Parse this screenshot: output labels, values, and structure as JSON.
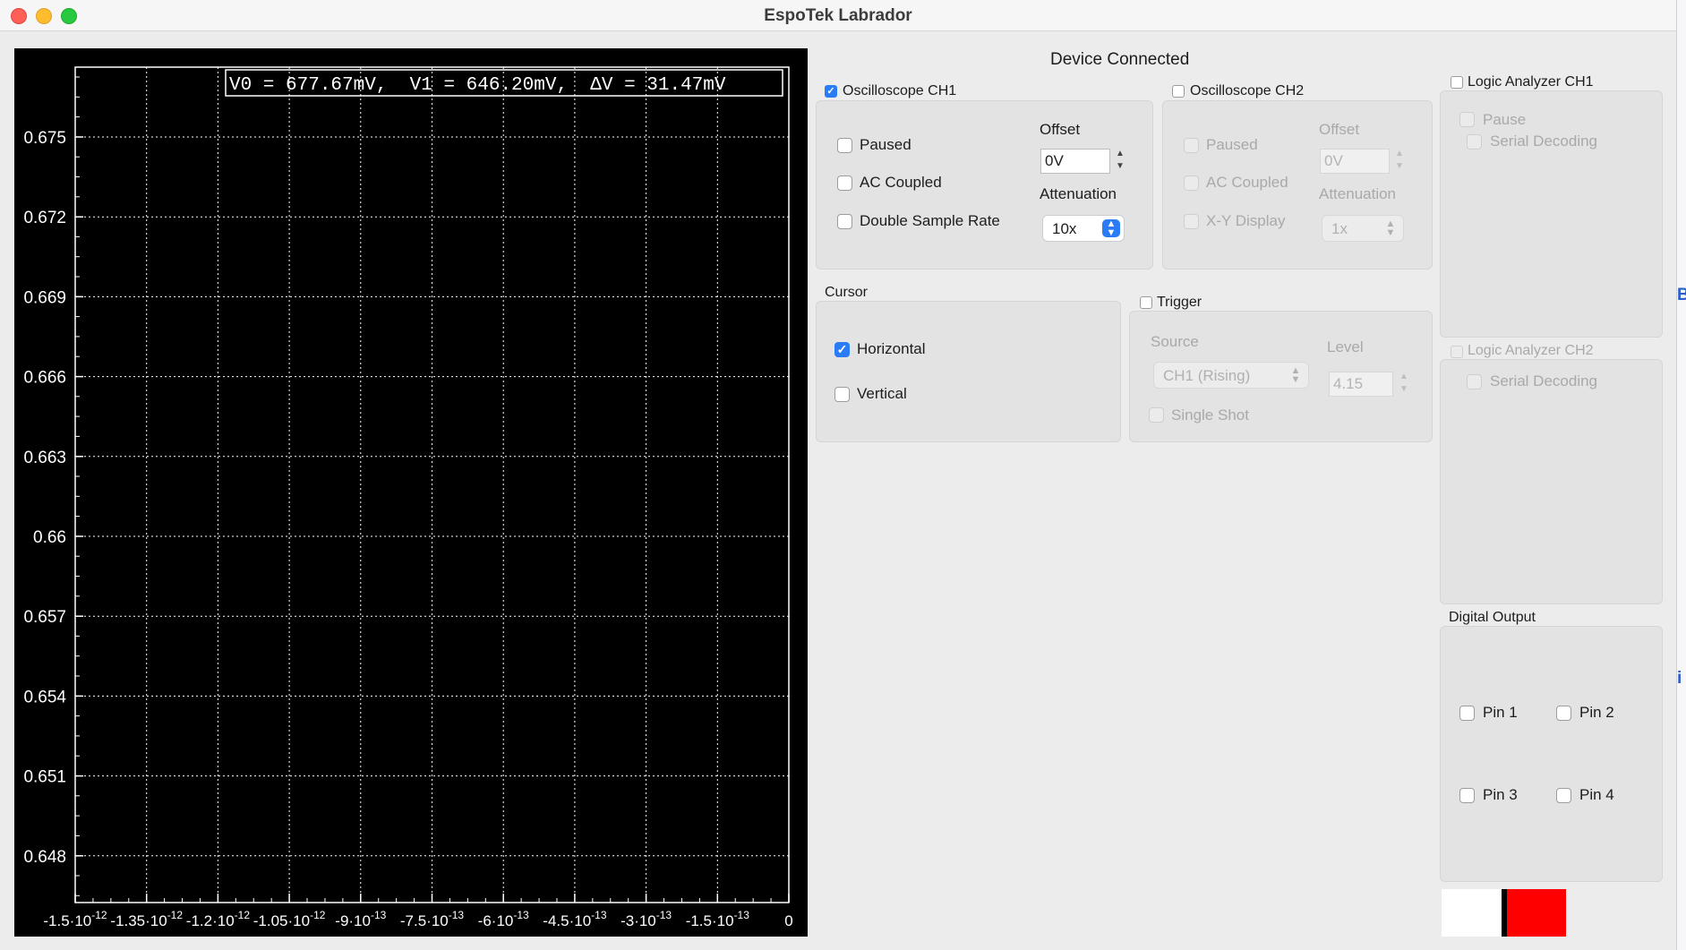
{
  "window": {
    "title": "EspoTek Labrador"
  },
  "status": {
    "text": "Device Connected"
  },
  "scope": {
    "readout": "V0 = 677.67mV,  V1 = 646.20mV,  ΔV = 31.47mV",
    "yticks": [
      "0.675",
      "0.672",
      "0.669",
      "0.666",
      "0.663",
      "0.66",
      "0.657",
      "0.654",
      "0.651",
      "0.648"
    ],
    "xticks": [
      "-1.5·10",
      "-1.35·10",
      "-1.2·10",
      "-1.05·10",
      "-9·10",
      "-7.5·10",
      "-6·10",
      "-4.5·10",
      "-3·10",
      "-1.5·10",
      "0"
    ],
    "xexps": [
      "-12",
      "-12",
      "-12",
      "-12",
      "-13",
      "-13",
      "-13",
      "-13",
      "-13",
      "-13",
      ""
    ]
  },
  "ch1": {
    "label": "Oscilloscope CH1",
    "enabled": true,
    "paused": "Paused",
    "ac_coupled": "AC Coupled",
    "double_rate": "Double Sample Rate",
    "offset_label": "Offset",
    "offset_value": "0V",
    "atten_label": "Attenuation",
    "atten_value": "10x"
  },
  "ch2": {
    "label": "Oscilloscope CH2",
    "enabled": false,
    "paused": "Paused",
    "ac_coupled": "AC Coupled",
    "xy_display": "X-Y Display",
    "offset_label": "Offset",
    "offset_value": "0V",
    "atten_label": "Attenuation",
    "atten_value": "1x"
  },
  "cursor": {
    "label": "Cursor",
    "horizontal": "Horizontal",
    "horizontal_checked": true,
    "vertical": "Vertical"
  },
  "trigger": {
    "label": "Trigger",
    "source_label": "Source",
    "source_value": "CH1 (Rising)",
    "level_label": "Level",
    "level_value": "4.15",
    "single_shot": "Single Shot"
  },
  "logic1": {
    "label": "Logic Analyzer CH1",
    "pause": "Pause",
    "serial": "Serial Decoding"
  },
  "logic2": {
    "label": "Logic Analyzer CH2",
    "serial": "Serial Decoding"
  },
  "digital": {
    "label": "Digital Output",
    "pins": [
      "Pin 1",
      "Pin 2",
      "Pin 3",
      "Pin 4"
    ]
  },
  "colors": {
    "accent": "#2a7cf6",
    "indicator_red": "#ff0000"
  },
  "edge": {
    "text1": "B",
    "text2": "i"
  }
}
